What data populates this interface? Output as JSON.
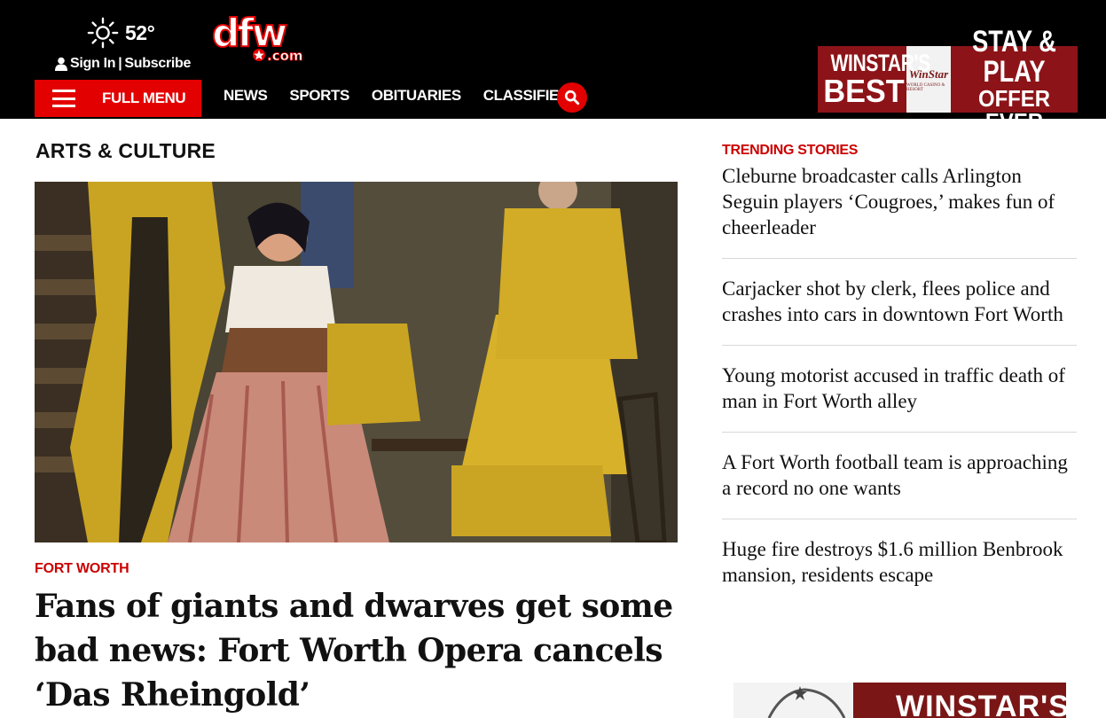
{
  "header": {
    "weather": {
      "icon": "sun-icon",
      "temperature": "52°"
    },
    "auth": {
      "icon": "user-icon",
      "sign_in": "Sign In",
      "separator": "|",
      "subscribe": "Subscribe"
    },
    "logo": {
      "main": "dfw",
      "sub": ".com"
    },
    "menu_button": {
      "label": "FULL MENU",
      "icon": "hamburger-icon"
    },
    "nav": [
      "NEWS",
      "SPORTS",
      "OBITUARIES",
      "CLASSIFIEDS"
    ],
    "search": {
      "icon": "search-icon"
    },
    "ad_top": {
      "left_line1": "WINSTAR'S",
      "left_line2": "BEST",
      "mid_line1": "WinStar",
      "mid_line2": "WORLD CASINO & RESORT",
      "right_line1": "STAY & PLAY",
      "right_line2": "OFFER EVER"
    }
  },
  "main": {
    "section_title": "ARTS & CULTURE",
    "article": {
      "kicker": "FORT WORTH",
      "headline": "Fans of giants and dwarves get some bad news: Fort Worth Opera cancels ‘Das Rheingold’"
    }
  },
  "sidebar": {
    "trending_title": "TRENDING STORIES",
    "stories": [
      "Cleburne broadcaster calls Arlington Seguin players ‘Cougroes,’ makes fun of cheerleader",
      "Carjacker shot by clerk, flees police and crashes into cars in downtown Fort Worth",
      "Young motorist accused in traffic death of man in Fort Worth alley",
      "A Fort Worth football team is approaching a record no one wants",
      "Huge fire destroys $1.6 million Benbrook mansion, residents escape"
    ],
    "ad_bottom": {
      "text": "WINSTAR'S"
    }
  },
  "colors": {
    "header_bg": "#000000",
    "accent_red": "#e30000",
    "kicker_red": "#cc0000",
    "ad_maroon": "#8c1418"
  }
}
